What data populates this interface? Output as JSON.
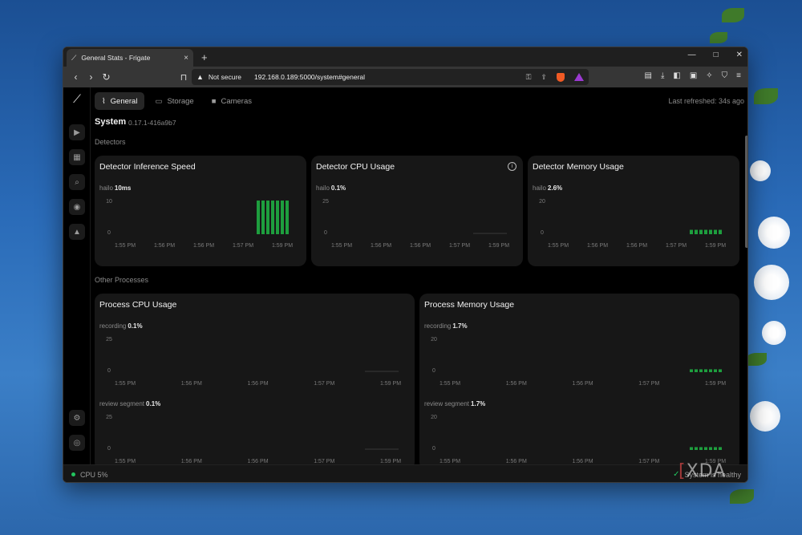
{
  "browser": {
    "tab_title": "General Stats - Frigate",
    "tab_close": "×",
    "new_tab": "+",
    "window_controls": {
      "minimize": "—",
      "maximize": "□",
      "close": "✕"
    },
    "url_security": "Not secure",
    "url": "192.168.0.189:5000/system#general"
  },
  "topnav": {
    "items": [
      {
        "label": "General",
        "icon": "activity-icon",
        "active": true
      },
      {
        "label": "Storage",
        "icon": "storage-icon",
        "active": false
      },
      {
        "label": "Cameras",
        "icon": "camera-icon",
        "active": false
      }
    ],
    "last_refreshed": "Last refreshed: 34s ago"
  },
  "system": {
    "title": "System",
    "version": "0.17.1-416a9b7"
  },
  "sections": {
    "detectors": "Detectors",
    "other_processes": "Other Processes"
  },
  "cards": {
    "inference": {
      "title": "Detector Inference Speed",
      "metric_name": "hailo",
      "metric_value": "10ms"
    },
    "cpu": {
      "title": "Detector CPU Usage",
      "metric_name": "hailo",
      "metric_value": "0.1%"
    },
    "memory": {
      "title": "Detector Memory Usage",
      "metric_name": "hailo",
      "metric_value": "2.6%"
    },
    "proc_cpu": {
      "title": "Process CPU Usage",
      "m1_name": "recording",
      "m1_value": "0.1%",
      "m2_name": "review segment",
      "m2_value": "0.1%"
    },
    "proc_mem": {
      "title": "Process Memory Usage",
      "m1_name": "recording",
      "m1_value": "1.7%",
      "m2_name": "review segment",
      "m2_value": "1.7%"
    }
  },
  "status": {
    "cpu": "CPU 5%",
    "right": "System is healthy"
  },
  "watermark": {
    "brand": "XDA"
  },
  "colors": {
    "accent_green": "#22c55e",
    "bar_green": "#1e9e3e",
    "card_bg": "#171717"
  },
  "chart_data": [
    {
      "type": "bar",
      "title": "Detector Inference Speed",
      "series": [
        {
          "name": "hailo",
          "values": [
            10,
            10,
            10,
            10,
            10,
            10,
            10
          ]
        }
      ],
      "x": [
        "1:58:35 PM",
        "1:58:40 PM",
        "1:58:45 PM",
        "1:58:50 PM",
        "1:58:55 PM",
        "1:59:00 PM",
        "1:59:05 PM"
      ],
      "ylim": [
        0,
        10
      ],
      "yticks": [
        "10",
        "0"
      ],
      "xticks": [
        "1:55 PM",
        "1:56 PM",
        "1:56 PM",
        "1:57 PM",
        "1:59 PM"
      ]
    },
    {
      "type": "line",
      "title": "Detector CPU Usage",
      "series": [
        {
          "name": "hailo",
          "values": [
            0.1,
            0.1,
            0.1,
            0.1,
            0.1,
            0.1,
            0.1
          ]
        }
      ],
      "ylim": [
        0,
        25
      ],
      "yticks": [
        "25",
        "0"
      ],
      "xticks": [
        "1:55 PM",
        "1:56 PM",
        "1:56 PM",
        "1:57 PM",
        "1:59 PM"
      ]
    },
    {
      "type": "bar",
      "title": "Detector Memory Usage",
      "series": [
        {
          "name": "hailo",
          "values": [
            2.6,
            2.6,
            2.6,
            2.6,
            2.6,
            2.6,
            2.6
          ]
        }
      ],
      "ylim": [
        0,
        20
      ],
      "yticks": [
        "20",
        "0"
      ],
      "xticks": [
        "1:55 PM",
        "1:56 PM",
        "1:56 PM",
        "1:57 PM",
        "1:59 PM"
      ]
    },
    {
      "type": "line",
      "title": "Process CPU Usage - recording",
      "series": [
        {
          "name": "recording",
          "values": [
            0.1,
            0.1,
            0.1,
            0.1,
            0.1,
            0.1,
            0.1
          ]
        }
      ],
      "ylim": [
        0,
        25
      ],
      "yticks": [
        "25",
        "0"
      ],
      "xticks": [
        "1:55 PM",
        "1:56 PM",
        "1:56 PM",
        "1:57 PM",
        "1:59 PM"
      ]
    },
    {
      "type": "bar",
      "title": "Process Memory Usage - recording",
      "series": [
        {
          "name": "recording",
          "values": [
            1.7,
            1.7,
            1.7,
            1.7,
            1.7,
            1.7,
            1.7
          ]
        }
      ],
      "ylim": [
        0,
        20
      ],
      "yticks": [
        "20",
        "0"
      ],
      "xticks": [
        "1:55 PM",
        "1:56 PM",
        "1:56 PM",
        "1:57 PM",
        "1:59 PM"
      ]
    },
    {
      "type": "line",
      "title": "Process CPU Usage - review segment",
      "series": [
        {
          "name": "review segment",
          "values": [
            0.1,
            0.1,
            0.1,
            0.1,
            0.1,
            0.1,
            0.1
          ]
        }
      ],
      "ylim": [
        0,
        25
      ],
      "yticks": [
        "25",
        "0"
      ],
      "xticks": [
        "1:55 PM",
        "1:56 PM",
        "1:56 PM",
        "1:57 PM",
        "1:59 PM"
      ]
    },
    {
      "type": "bar",
      "title": "Process Memory Usage - review segment",
      "series": [
        {
          "name": "review segment",
          "values": [
            1.7,
            1.7,
            1.7,
            1.7,
            1.7,
            1.7,
            1.7
          ]
        }
      ],
      "ylim": [
        0,
        20
      ],
      "yticks": [
        "20",
        "0"
      ],
      "xticks": [
        "1:55 PM",
        "1:56 PM",
        "1:56 PM",
        "1:57 PM",
        "1:59 PM"
      ]
    }
  ]
}
